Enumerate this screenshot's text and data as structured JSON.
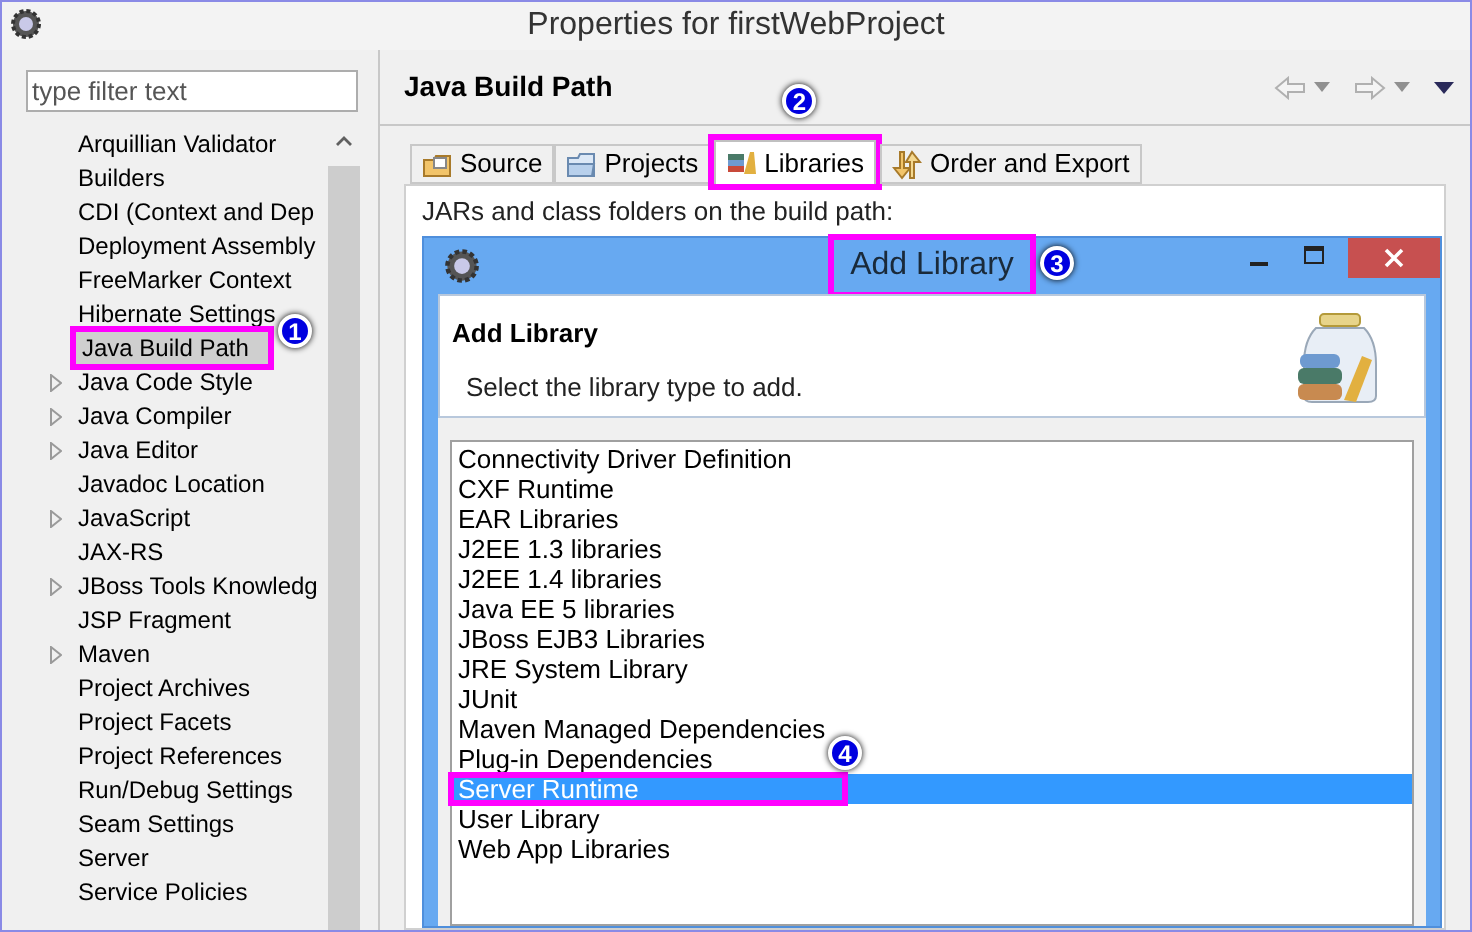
{
  "window": {
    "title": "Properties for firstWebProject"
  },
  "filter": {
    "placeholder": "type filter text"
  },
  "tree": {
    "items": [
      {
        "label": "Arquillian Validator",
        "expandable": false,
        "selected": false
      },
      {
        "label": "Builders",
        "expandable": false,
        "selected": false
      },
      {
        "label": "CDI (Context and Dep",
        "expandable": false,
        "selected": false
      },
      {
        "label": "Deployment Assembly",
        "expandable": false,
        "selected": false
      },
      {
        "label": "FreeMarker Context",
        "expandable": false,
        "selected": false
      },
      {
        "label": "Hibernate Settings",
        "expandable": false,
        "selected": false
      },
      {
        "label": "Java Build Path",
        "expandable": false,
        "selected": true,
        "callout": "1"
      },
      {
        "label": "Java Code Style",
        "expandable": true,
        "selected": false
      },
      {
        "label": "Java Compiler",
        "expandable": true,
        "selected": false
      },
      {
        "label": "Java Editor",
        "expandable": true,
        "selected": false
      },
      {
        "label": "Javadoc Location",
        "expandable": false,
        "selected": false
      },
      {
        "label": "JavaScript",
        "expandable": true,
        "selected": false
      },
      {
        "label": "JAX-RS",
        "expandable": false,
        "selected": false
      },
      {
        "label": "JBoss Tools Knowledg",
        "expandable": true,
        "selected": false
      },
      {
        "label": "JSP Fragment",
        "expandable": false,
        "selected": false
      },
      {
        "label": "Maven",
        "expandable": true,
        "selected": false
      },
      {
        "label": "Project Archives",
        "expandable": false,
        "selected": false
      },
      {
        "label": "Project Facets",
        "expandable": false,
        "selected": false
      },
      {
        "label": "Project References",
        "expandable": false,
        "selected": false
      },
      {
        "label": "Run/Debug Settings",
        "expandable": false,
        "selected": false
      },
      {
        "label": "Seam Settings",
        "expandable": false,
        "selected": false
      },
      {
        "label": "Server",
        "expandable": false,
        "selected": false
      },
      {
        "label": "Service Policies",
        "expandable": false,
        "selected": false
      }
    ]
  },
  "page": {
    "title": "Java Build Path",
    "tabs": [
      {
        "label": "Source",
        "selected": false
      },
      {
        "label": "Projects",
        "selected": false
      },
      {
        "label": "Libraries",
        "selected": true,
        "callout": "2"
      },
      {
        "label": "Order and Export",
        "selected": false
      }
    ],
    "description": "JARs and class folders on the build path:"
  },
  "dialog": {
    "title": "Add Library",
    "callout": "3",
    "heading": "Add Library",
    "message": "Select the library type to add.",
    "items": [
      {
        "label": "Connectivity Driver Definition",
        "selected": false
      },
      {
        "label": "CXF Runtime",
        "selected": false
      },
      {
        "label": "EAR Libraries",
        "selected": false
      },
      {
        "label": "J2EE 1.3 libraries",
        "selected": false
      },
      {
        "label": "J2EE 1.4 libraries",
        "selected": false
      },
      {
        "label": "Java EE 5 libraries",
        "selected": false
      },
      {
        "label": "JBoss EJB3 Libraries",
        "selected": false
      },
      {
        "label": "JRE System Library",
        "selected": false
      },
      {
        "label": "JUnit",
        "selected": false
      },
      {
        "label": "Maven Managed Dependencies",
        "selected": false
      },
      {
        "label": "Plug-in Dependencies",
        "selected": false
      },
      {
        "label": "Server Runtime",
        "selected": true,
        "callout": "4"
      },
      {
        "label": "User Library",
        "selected": false
      },
      {
        "label": "Web App Libraries",
        "selected": false
      }
    ]
  }
}
